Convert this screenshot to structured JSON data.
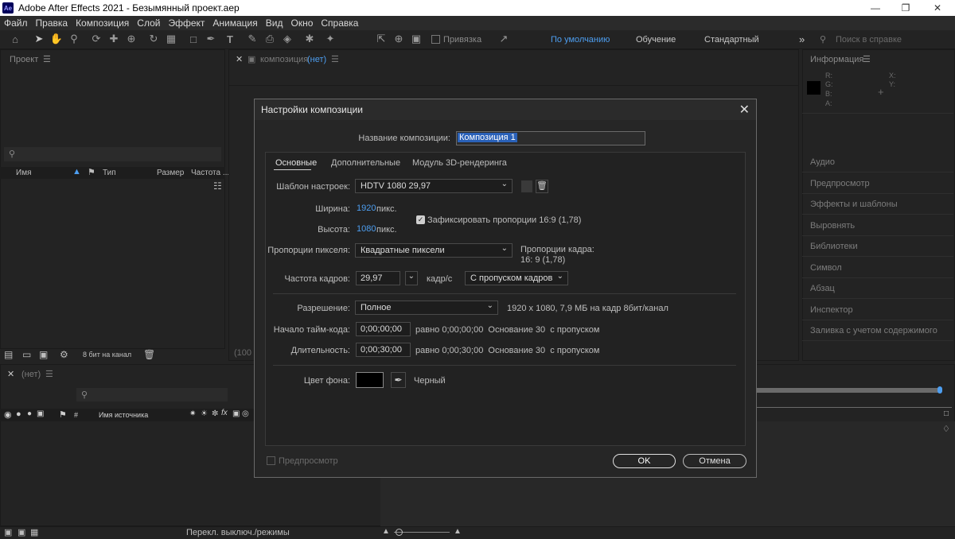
{
  "window": {
    "title": "Adobe After Effects 2021 - Безымянный проект.aep",
    "logo": "Ae"
  },
  "menu": [
    "Файл",
    "Правка",
    "Композиция",
    "Слой",
    "Эффект",
    "Анимация",
    "Вид",
    "Окно",
    "Справка"
  ],
  "toolbar": {
    "snap_label": "Привязка"
  },
  "workspaces": {
    "default": "По умолчанию",
    "learn": "Обучение",
    "standard": "Стандартный",
    "more": "»"
  },
  "search_help": {
    "placeholder": "Поиск в справке"
  },
  "project": {
    "title": "Проект",
    "columns": [
      "Имя",
      "Тип",
      "Размер",
      "Частота ..."
    ],
    "bit_depth": "8 бит на канал"
  },
  "composition": {
    "title_prefix": "композиция",
    "title_value": "(нет)",
    "zoom": "(100"
  },
  "info": {
    "title": "Информация",
    "rgba": [
      "R:",
      "G:",
      "B:",
      "A:"
    ],
    "xy": [
      "X:",
      "Y:"
    ]
  },
  "right_panels": [
    "Аудио",
    "Предпросмотр",
    "Эффекты и шаблоны",
    "Выровнять",
    "Библиотеки",
    "Символ",
    "Абзац",
    "Инспектор",
    "Заливка с учетом содержимого"
  ],
  "timeline": {
    "title": "(нет)",
    "source_col": "Имя источника",
    "footer": "Перекл. выключ./режимы"
  },
  "dialog": {
    "title": "Настройки композиции",
    "name_label": "Название композиции:",
    "name_value": "Композиция 1",
    "tabs": [
      "Основные",
      "Дополнительные",
      "Модуль 3D-рендеринга"
    ],
    "preset_label": "Шаблон настроек:",
    "preset_value": "HDTV 1080 29,97",
    "width_label": "Ширина:",
    "width_value": "1920",
    "height_label": "Высота:",
    "height_value": "1080",
    "px_unit": "пикс.",
    "lock_label": "Зафиксировать пропорции 16:9 (1,78)",
    "par_label": "Пропорции пикселя:",
    "par_value": "Квадратные пиксели",
    "frame_aspect_label": "Пропорции кадра:",
    "frame_aspect_value": "16: 9 (1,78)",
    "fps_label": "Частота кадров:",
    "fps_value": "29,97",
    "fps_unit": "кадр/с",
    "drop_value": "С пропуском кадров",
    "res_label": "Разрешение:",
    "res_value": "Полное",
    "res_info": "1920 x 1080, 7,9 МБ на кадр 8бит/канал",
    "tc_label": "Начало тайм-кода:",
    "tc_value": "0;00;00;00",
    "tc_info": "равно 0;00;00;00  Основание 30  с пропуском",
    "dur_label": "Длительность:",
    "dur_value": "0;00;30;00",
    "dur_info": "равно 0;00;30;00  Основание 30  с пропуском",
    "bg_label": "Цвет фона:",
    "bg_name": "Черный",
    "bg_color": "#000000",
    "preview_label": "Предпросмотр",
    "ok": "OK",
    "cancel": "Отмена"
  },
  "colors": {
    "accent": "#4d9ef0"
  }
}
